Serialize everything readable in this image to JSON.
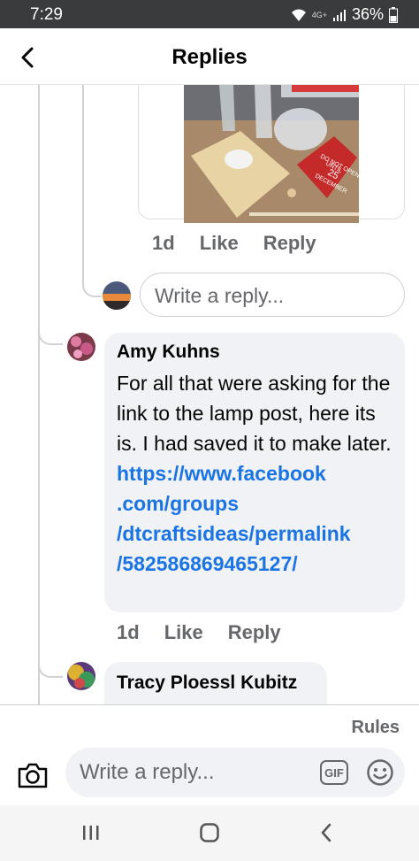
{
  "status_bar": {
    "time": "7:29",
    "network": "4G+",
    "battery": "36%"
  },
  "header": {
    "title": "Replies"
  },
  "first_reply": {
    "photo_text": [
      "DO NOT OPEN",
      "UNTIL",
      "25",
      "DECEMBER"
    ],
    "actions": {
      "time": "1d",
      "like": "Like",
      "reply": "Reply"
    }
  },
  "reply_box": {
    "placeholder": "Write a reply..."
  },
  "comments": [
    {
      "author": "Amy Kuhns",
      "text": "For all that were asking for the link to the lamp post, here its is.  I had saved it to make later.",
      "link": "https://www.facebook.com/groups/dtcraftsideas/permalink/582586869465127/",
      "link_lines": [
        "https://www.facebook",
        ".com/groups",
        "/dtcraftsideas/permalink",
        "/582586869465127/"
      ],
      "actions": {
        "time": "1d",
        "like": "Like",
        "reply": "Reply"
      }
    },
    {
      "author": "Tracy Ploessl Kubitz"
    }
  ],
  "footer": {
    "rules": "Rules",
    "input_placeholder": "Write a reply...",
    "gif_label": "GIF"
  },
  "colors": {
    "link": "#1b74e4",
    "bubble": "#f0f2f5",
    "muted": "#65676b"
  }
}
